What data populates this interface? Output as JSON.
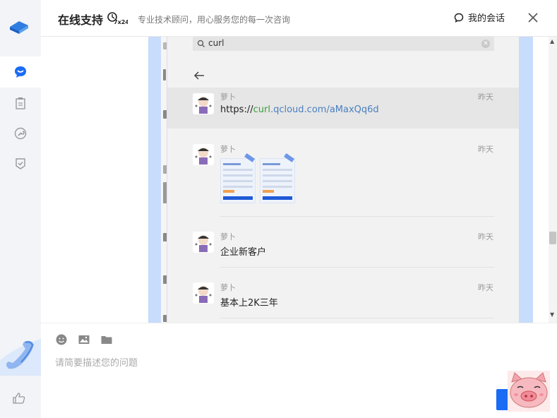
{
  "header": {
    "title": "在线支持",
    "badge": "7x24",
    "subtitle": "专业技术顾问，用心服务您的每一次咨询",
    "sessions_label": "我的会话"
  },
  "search": {
    "query": "curl"
  },
  "messages": [
    {
      "sender": "萝卜",
      "time": "昨天",
      "link_prefix": "https://",
      "link_highlight": "curl",
      "link_suffix": ".qcloud.com/aMaxQq6d"
    },
    {
      "sender": "萝卜",
      "time": "昨天",
      "body": ""
    },
    {
      "sender": "萝卜",
      "time": "昨天",
      "body": "企业新客户"
    },
    {
      "sender": "萝卜",
      "time": "昨天",
      "body": "基本上2K三年"
    }
  ],
  "composer": {
    "placeholder": "请简要描述您的问题"
  },
  "colors": {
    "accent": "#1a6cf5",
    "highlight": "#3aa03a",
    "rail_bg": "#f2f4f8"
  },
  "icons": {
    "nav": [
      "chat-icon",
      "clipboard-icon",
      "wrench-icon",
      "shield-icon"
    ],
    "tools": [
      "emoji-icon",
      "image-icon",
      "folder-icon"
    ]
  }
}
